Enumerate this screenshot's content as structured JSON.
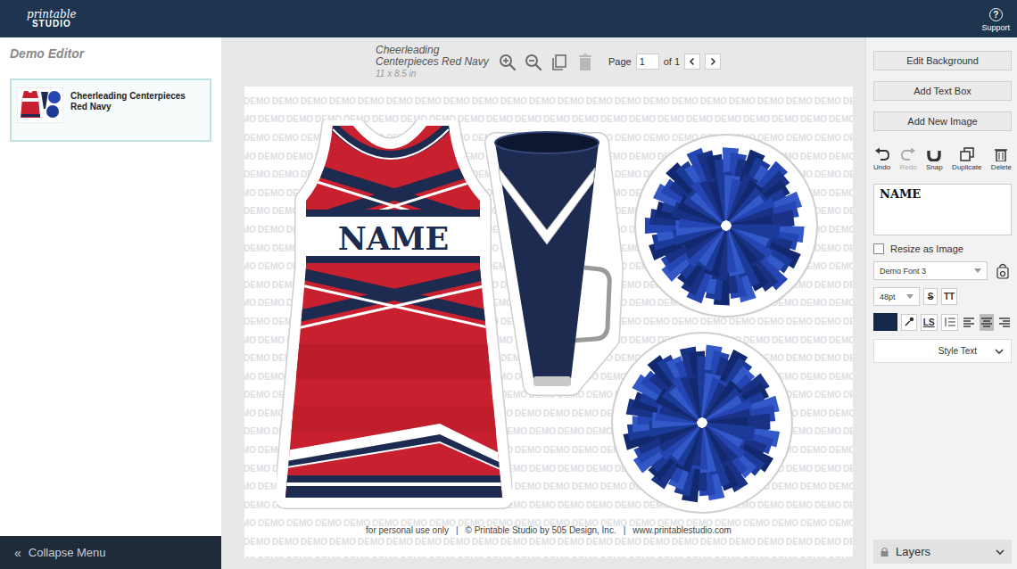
{
  "header": {
    "logo_script": "printable",
    "logo_word": "STUDIO",
    "support_icon": "?",
    "support_label": "Support"
  },
  "sidebar": {
    "title": "Demo Editor",
    "items": [
      {
        "label": "Cheerleading Centerpieces Red Navy",
        "selected": true
      }
    ],
    "collapse_icon": "«",
    "collapse_label": "Collapse Menu"
  },
  "toolbar": {
    "title": "Cheerleading Centerpieces Red Navy",
    "size": "11 x 8.5 in",
    "tools": [
      {
        "kind": "zoom-in",
        "disabled": false
      },
      {
        "kind": "zoom-out",
        "disabled": false
      },
      {
        "kind": "copy",
        "disabled": false
      },
      {
        "kind": "delete",
        "disabled": true
      }
    ],
    "page_label": "Page",
    "page_value": "1",
    "page_total": "of 1"
  },
  "canvas": {
    "watermark": "DEMO",
    "name_text": "NAME",
    "footer": [
      "for personal use only",
      "© Printable Studio by 505 Design, Inc.",
      "www.printablestudio.com"
    ],
    "footer_separator": "|"
  },
  "panel": {
    "buttons": [
      "Edit Background",
      "Add Text Box",
      "Add New Image"
    ],
    "actions": [
      {
        "kind": "undo",
        "label": "Undo",
        "disabled": false
      },
      {
        "kind": "redo",
        "label": "Redo",
        "disabled": true
      },
      {
        "kind": "snap",
        "label": "Snap",
        "disabled": false
      },
      {
        "kind": "duplicate",
        "label": "Duplicate",
        "disabled": false
      },
      {
        "kind": "delete",
        "label": "Delete",
        "disabled": false
      }
    ],
    "text_value": "NAME",
    "resize_label": "Resize as Image",
    "resize_checked": false,
    "font": "Demo Font 3",
    "font_size": "48pt",
    "strike": "S",
    "caps": "TT",
    "text_color": "#142849",
    "letter_spacing": "LS",
    "align": [
      {
        "kind": "left",
        "selected": false
      },
      {
        "kind": "center",
        "selected": true
      },
      {
        "kind": "right",
        "selected": false
      }
    ],
    "style_label": "Style Text",
    "layers_label": "Layers"
  }
}
